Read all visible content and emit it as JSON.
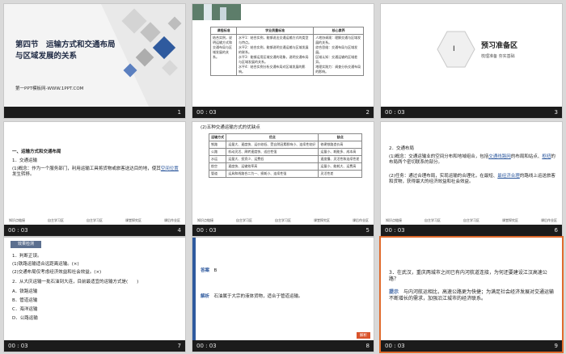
{
  "slides": [
    {
      "number": "1",
      "time": "",
      "title_line1": "第四节　运输方式和交通布局",
      "title_line2": "与区域发展的关系",
      "subtitle": "第一PPT模板网-WWW.1PPT.COM"
    },
    {
      "number": "2",
      "time": "00 : 03",
      "headers": [
        "课程标准",
        "学业质量标准",
        "核心素养"
      ],
      "col1": "结合实例，说明运输方式和交通布局与区域发展的关系。",
      "col2": [
        "水平1：结合实例，能够说出交通运输方式的类型与特点。",
        "水平2：结合实例，能够说明交通运输与区域发展的联系。",
        "水平3：能够运用区域交通的现象，说明交通布局与区域发展的关系。",
        "水平4：结合实例分析交通布局对区域发展的影响。"
      ],
      "col3": [
        "人地协调观：理解交通与区域发展的关系。",
        "综合思维：交通布局与区域发展。",
        "区域认知：交通运输的区域差异。",
        "地理实践力：调查分析交通布局的影响。"
      ]
    },
    {
      "number": "3",
      "time": "00 : 03",
      "circle_text": "Ⅰ",
      "heading": "预习准备区",
      "subheading": "梳理准备 夯实基础"
    },
    {
      "number": "4",
      "time": "00 : 03",
      "section": "一、运输方式和交通布局",
      "item1": "1．交通运输",
      "item1_text": "(1)概念：作为一个服务部门，利用运输工具将货物或旅客送达目的地，使其",
      "item1_blank": "空间位置",
      "item1_end": "发生转移。",
      "links": [
        "知识点链接",
        "自主学习区",
        "自主学习区",
        "课堂探究区",
        "课后作业区"
      ]
    },
    {
      "number": "5",
      "time": "00 : 03",
      "caption": "(2)五种交通运输方式的优缺点",
      "headers": [
        "运输方式",
        "优点",
        "缺点"
      ],
      "rows": [
        [
          "铁路",
          "运量大、速度快、运价较低、受自然因素影响小、连续性较好",
          "修建铁路造价高"
        ],
        [
          "公路",
          "机动灵活、周转速度快、适应性强",
          "运量小、耗能多、成本高"
        ],
        [
          "水运",
          "运量大、投资少、运费低",
          "速度慢、灵活性和连续性差"
        ],
        [
          "航空",
          "速度快、运输效率高",
          "运量小、能耗大、运费高"
        ],
        [
          "管道",
          "运具和线路合二为一、损耗小、连续性强",
          "灵活性差"
        ]
      ],
      "links": [
        "知识点链接",
        "自主学习区",
        "自主学习区",
        "课堂探究区",
        "课后作业区"
      ]
    },
    {
      "number": "6",
      "time": "00 : 03",
      "item2": "2．交通布局",
      "item2_text1": "(1)概念：交通运输业的空间分布和地域组合，包括",
      "item2_blank1": "交通线路网",
      "item2_text1b": "的布局和站点、",
      "item2_blank2": "枢纽",
      "item2_text1c": "的布局两个密切联系的部分。",
      "item2_text2": "(2)任务：通过合理布局，实现运输的合理化，在最短、",
      "item2_blank3": "最经济合理",
      "item2_text2b": "的路线上运送旅客和货物，获得最大的经济效益和社会效益。",
      "links": [
        "知识点链接",
        "自主学习区",
        "自主学习区",
        "课堂探究区",
        "课后作业区"
      ]
    },
    {
      "number": "7",
      "time": "00 : 03",
      "tag": "效果检测",
      "q1": "1．判断正误。",
      "q1a": "(1)铁路运输适合远距离运输。(×)",
      "q1b": "(2)交通布局仅考虑经济效益和社会效益。(×)",
      "q2": "2．从大庆运输一批石油到大连，目前最适宜的运输方式是(　　)",
      "options": [
        "A．铁路运输",
        "B．管道运输",
        "C．海洋运输",
        "D．公路运输"
      ]
    },
    {
      "number": "8",
      "time": "00 : 03",
      "answer_label": "答案",
      "answer": "B",
      "analysis_label": "解析",
      "analysis": "石油属于大宗的液体货物，适合于管道运输。",
      "badge": "解析"
    },
    {
      "number": "9",
      "time": "00 : 03",
      "question": "3．在武汉，重庆两城市之间已有内河航道连接，为何还要建设江汉高速公路？",
      "hint_label": "提示",
      "hint": "与内河航运相比，高速公路更为快捷；为满足社会经济发展对交通运输不断增长的需求，加强沿江城市的经济联系。"
    }
  ]
}
